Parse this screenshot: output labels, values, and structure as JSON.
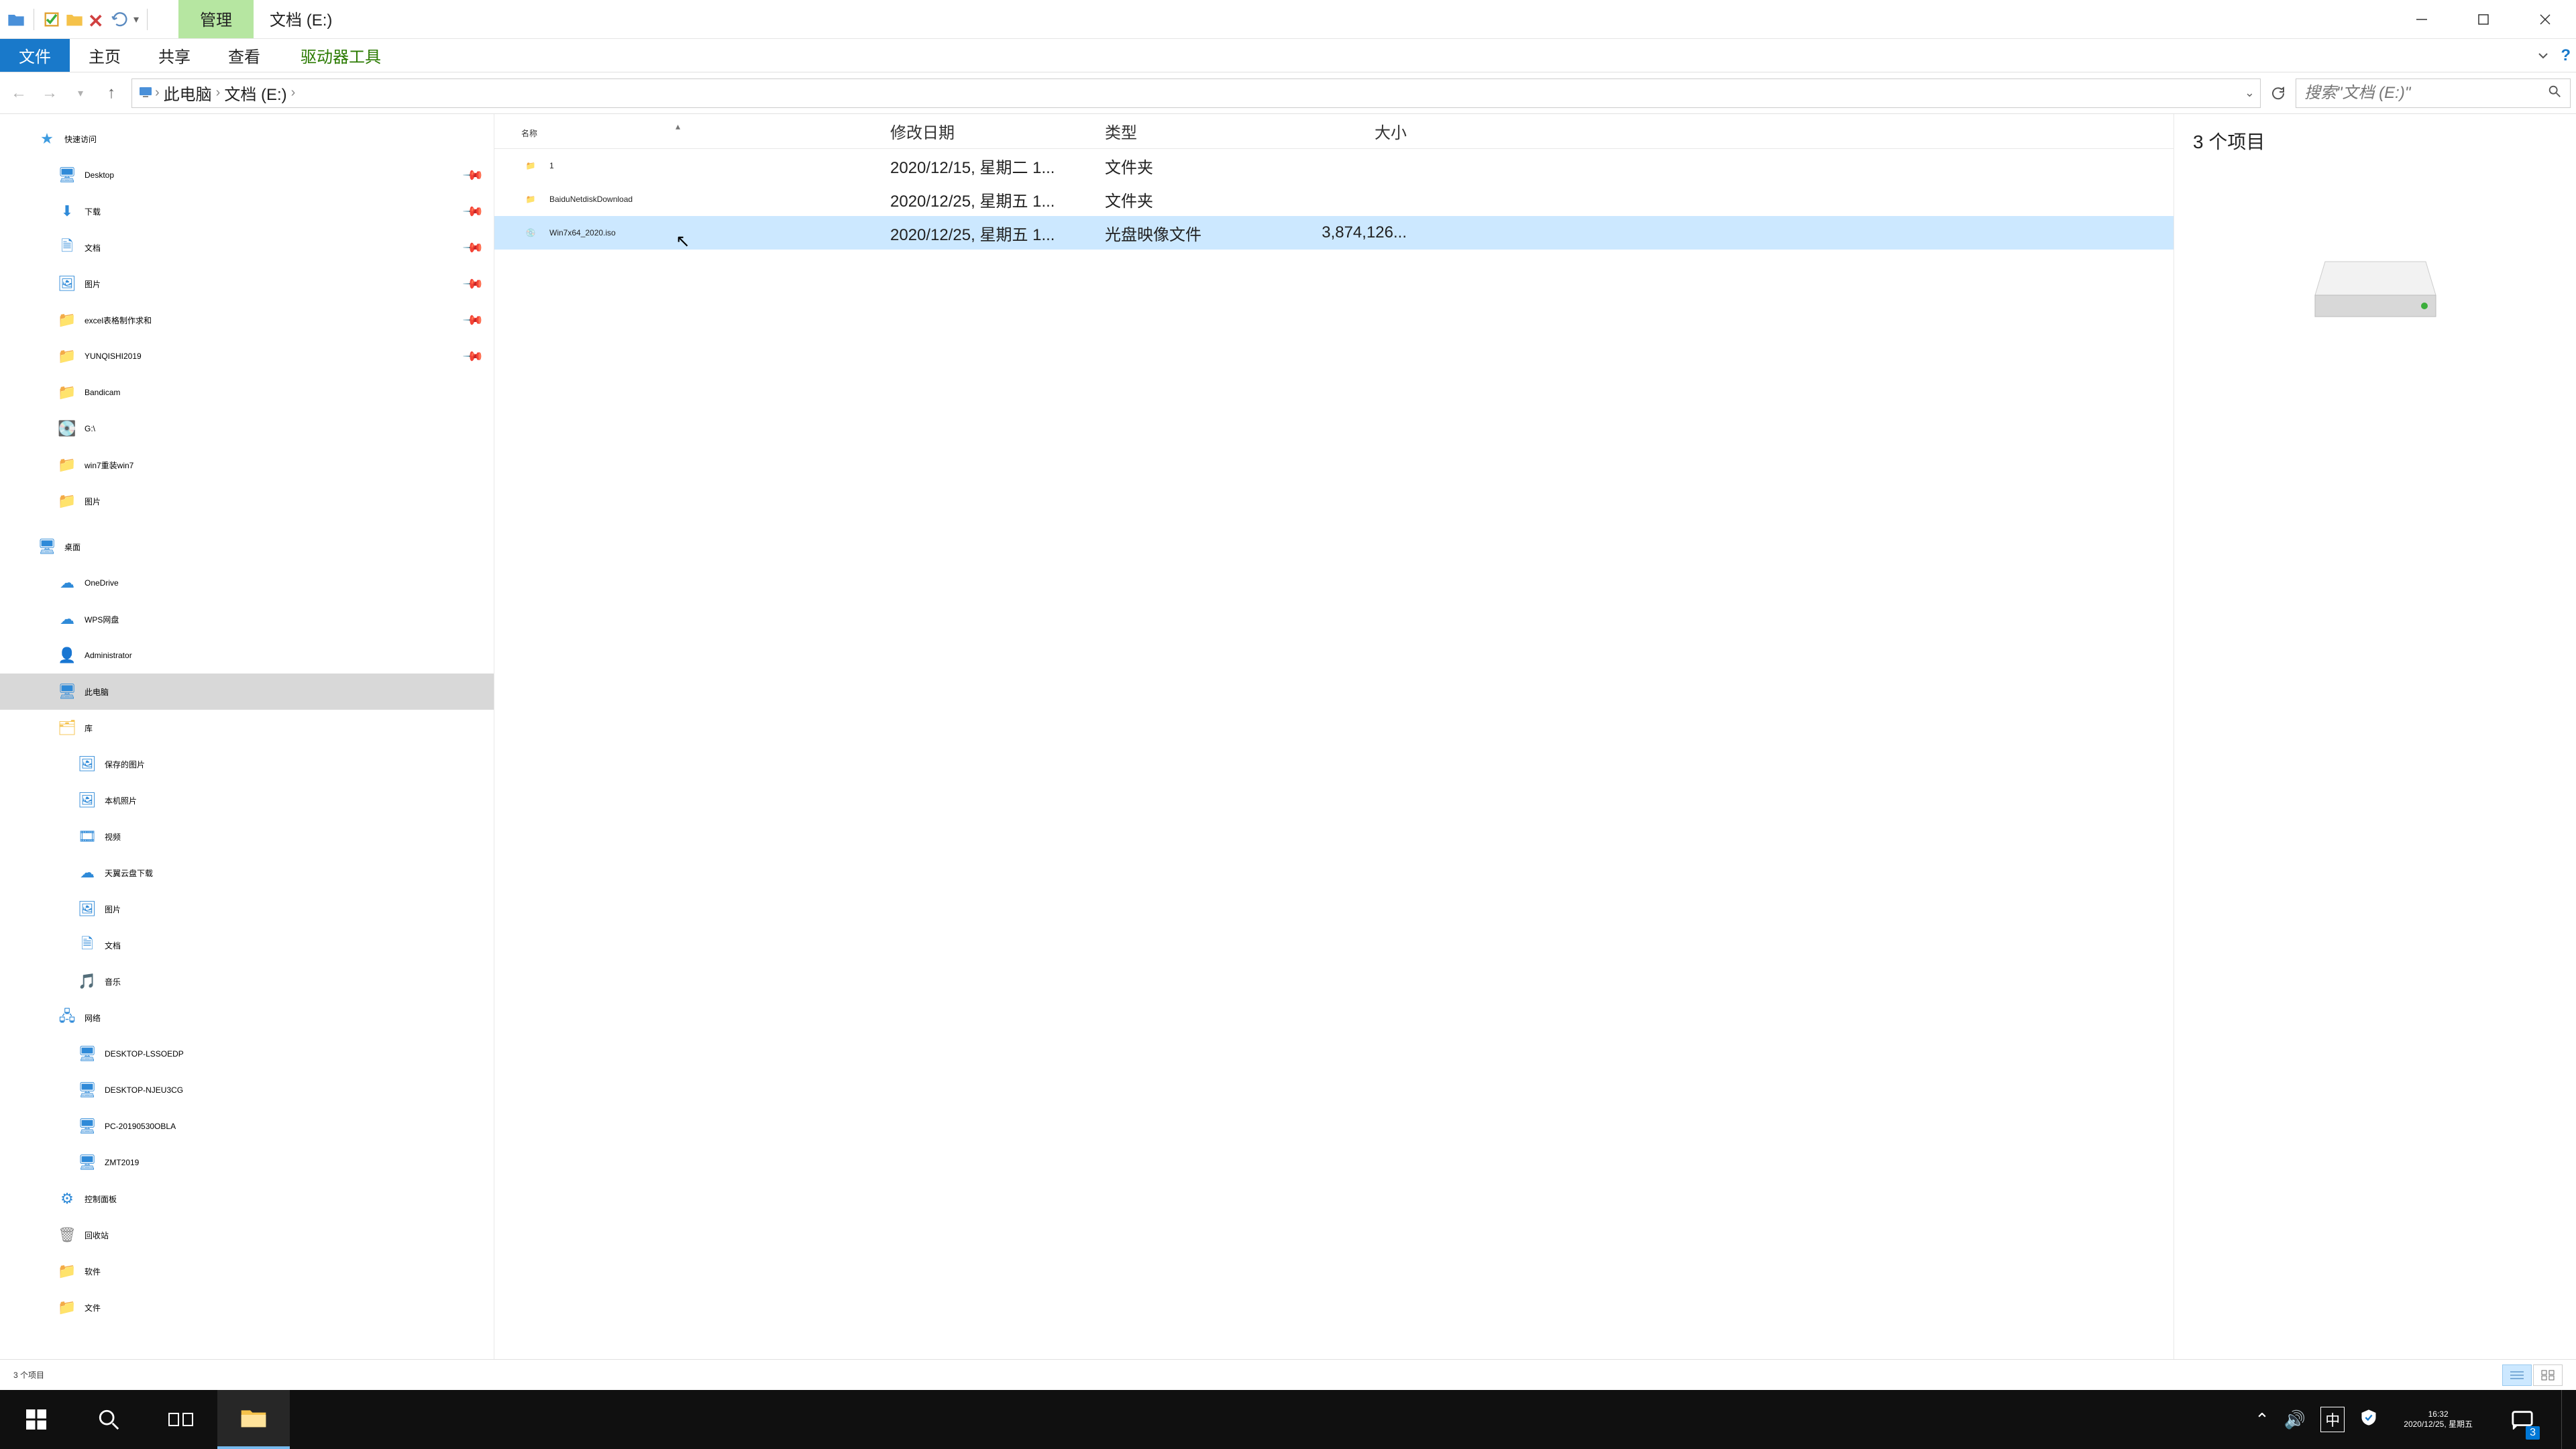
{
  "titlebar": {
    "contextual_tab": "管理",
    "window_title": "文档 (E:)"
  },
  "ribbon": {
    "file": "文件",
    "tabs": [
      "主页",
      "共享",
      "查看"
    ],
    "context_tab": "驱动器工具"
  },
  "breadcrumb": {
    "root_icon": "pc",
    "segments": [
      "此电脑",
      "文档 (E:)"
    ]
  },
  "search": {
    "placeholder": "搜索\"文档 (E:)\""
  },
  "nav": {
    "quick": {
      "label": "快速访问",
      "items": [
        {
          "label": "Desktop",
          "icon": "desktop",
          "pin": true
        },
        {
          "label": "下载",
          "icon": "download",
          "pin": true
        },
        {
          "label": "文档",
          "icon": "doc",
          "pin": true
        },
        {
          "label": "图片",
          "icon": "pic",
          "pin": true
        },
        {
          "label": "excel表格制作求和",
          "icon": "folder",
          "pin": true
        },
        {
          "label": "YUNQISHI2019",
          "icon": "folder",
          "pin": true
        },
        {
          "label": "Bandicam",
          "icon": "folder",
          "pin": false
        },
        {
          "label": "G:\\",
          "icon": "drive",
          "pin": false
        },
        {
          "label": "win7重装win7",
          "icon": "folder",
          "pin": false
        },
        {
          "label": "图片",
          "icon": "folder",
          "pin": false
        }
      ]
    },
    "desktop": {
      "label": "桌面",
      "items": [
        {
          "label": "OneDrive",
          "icon": "onedrive"
        },
        {
          "label": "WPS网盘",
          "icon": "wps"
        },
        {
          "label": "Administrator",
          "icon": "user"
        },
        {
          "label": "此电脑",
          "icon": "pc",
          "selected": true
        },
        {
          "label": "库",
          "icon": "lib"
        },
        {
          "label": "保存的图片",
          "icon": "pic",
          "indent": 1
        },
        {
          "label": "本机照片",
          "icon": "pic",
          "indent": 1
        },
        {
          "label": "视频",
          "icon": "video",
          "indent": 1
        },
        {
          "label": "天翼云盘下载",
          "icon": "cloud",
          "indent": 1
        },
        {
          "label": "图片",
          "icon": "pic",
          "indent": 1
        },
        {
          "label": "文档",
          "icon": "doc",
          "indent": 1
        },
        {
          "label": "音乐",
          "icon": "music",
          "indent": 1
        },
        {
          "label": "网络",
          "icon": "net"
        },
        {
          "label": "DESKTOP-LSSOEDP",
          "icon": "netpc",
          "indent": 1
        },
        {
          "label": "DESKTOP-NJEU3CG",
          "icon": "netpc",
          "indent": 1
        },
        {
          "label": "PC-20190530OBLA",
          "icon": "netpc",
          "indent": 1
        },
        {
          "label": "ZMT2019",
          "icon": "netpc",
          "indent": 1
        },
        {
          "label": "控制面板",
          "icon": "cpl"
        },
        {
          "label": "回收站",
          "icon": "recycle"
        },
        {
          "label": "软件",
          "icon": "folder"
        },
        {
          "label": "文件",
          "icon": "folder"
        }
      ]
    }
  },
  "columns": {
    "name": "名称",
    "date": "修改日期",
    "type": "类型",
    "size": "大小"
  },
  "files": [
    {
      "name": "1",
      "date": "2020/12/15, 星期二 1...",
      "type": "文件夹",
      "size": "",
      "icon": "folder"
    },
    {
      "name": "BaiduNetdiskDownload",
      "date": "2020/12/25, 星期五 1...",
      "type": "文件夹",
      "size": "",
      "icon": "folder"
    },
    {
      "name": "Win7x64_2020.iso",
      "date": "2020/12/25, 星期五 1...",
      "type": "光盘映像文件",
      "size": "3,874,126...",
      "icon": "iso",
      "selected": true
    }
  ],
  "preview": {
    "count_label": "3 个项目"
  },
  "status": {
    "text": "3 个项目"
  },
  "taskbar": {
    "time": "16:32",
    "date": "2020/12/25, 星期五",
    "ime": "中",
    "badge": "3"
  }
}
